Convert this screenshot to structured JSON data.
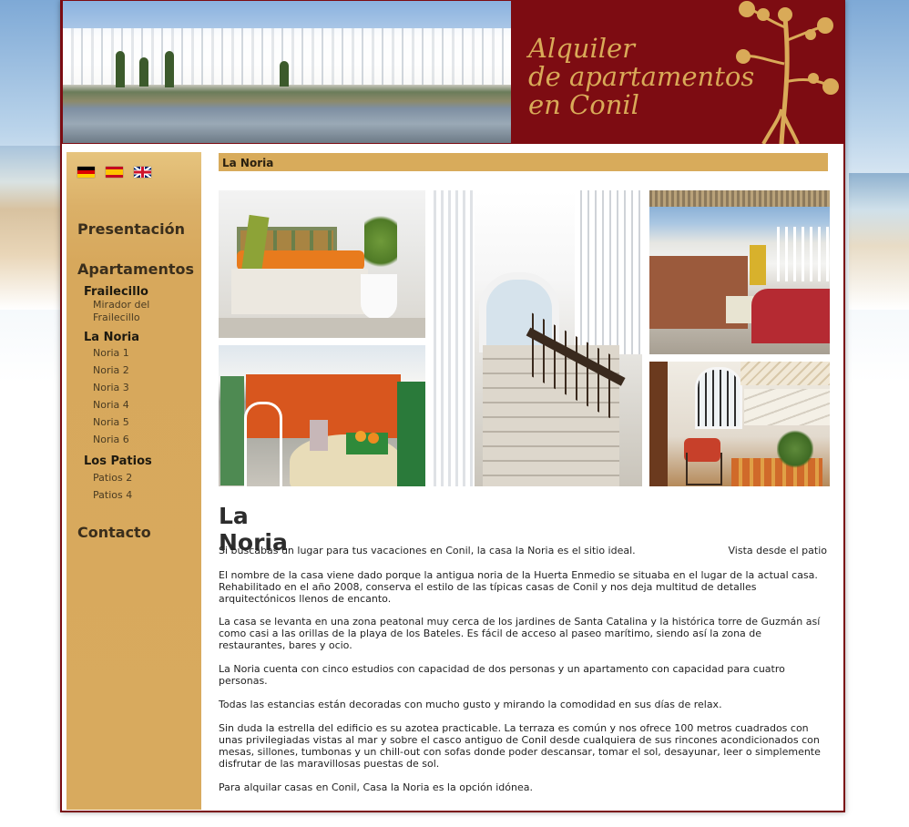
{
  "header": {
    "title_line1": "Alquiler",
    "title_line2": "de apartamentos",
    "title_line3": "en Conil"
  },
  "languages": [
    "de",
    "es",
    "en"
  ],
  "sidebar": {
    "presentacion": "Presentación",
    "apartamentos": "Apartamentos",
    "frailecillo": "Frailecillo",
    "mirador_line1": "Mirador del",
    "mirador_line2": "Frailecillo",
    "la_noria": "La Noria",
    "noria_items": [
      "Noria 1",
      "Noria 2",
      "Noria 3",
      "Noria 4",
      "Noria 5",
      "Noria 6"
    ],
    "los_patios": "Los Patios",
    "patios_items": [
      "Patios 2",
      "Patios 4"
    ],
    "contacto": "Contacto"
  },
  "content": {
    "bar_title": "La Noria",
    "heading": "La Noria",
    "caption": "Vista desde el patio",
    "paragraphs": [
      "Si buscabas un lugar para tus vacaciones en Conil, la casa la Noria es el sitio ideal.",
      "El nombre de la casa viene dado porque la antigua noria de la Huerta Enmedio se situaba en el lugar de la actual casa. Rehabilitado en el año 2008, conserva el estilo de las típicas casas de Conil y nos deja multitud de detalles arquitectónicos llenos de encanto.",
      "La casa se levanta en una zona peatonal muy cerca de los jardines de Santa Catalina y la histórica torre de Guzmán así como casi a las orillas de la playa de los Bateles. Es fácil de acceso al paseo marítimo, siendo así la zona de restaurantes, bares y ocio.",
      "La Noria cuenta con cinco estudios con capacidad de dos personas  y un apartamento con capacidad para cuatro personas.",
      "Todas las estancias están decoradas con mucho gusto y mirando la comodidad en sus días de relax.",
      "Sin duda la estrella del edificio es su azotea practicable. La terraza es común y nos ofrece 100 metros cuadrados con unas privilegiadas vistas al mar y sobre el casco antiguo de Conil desde cualquiera de sus rincones acondicionados con mesas, sillones, tumbonas y un chill-out con sofas donde poder descansar, tomar el sol, desayunar, leer o simplemente disfrutar de las maravillosas puestas de sol.",
      "Para alquilar casas en Conil, Casa la Noria es la opción idónea."
    ]
  }
}
